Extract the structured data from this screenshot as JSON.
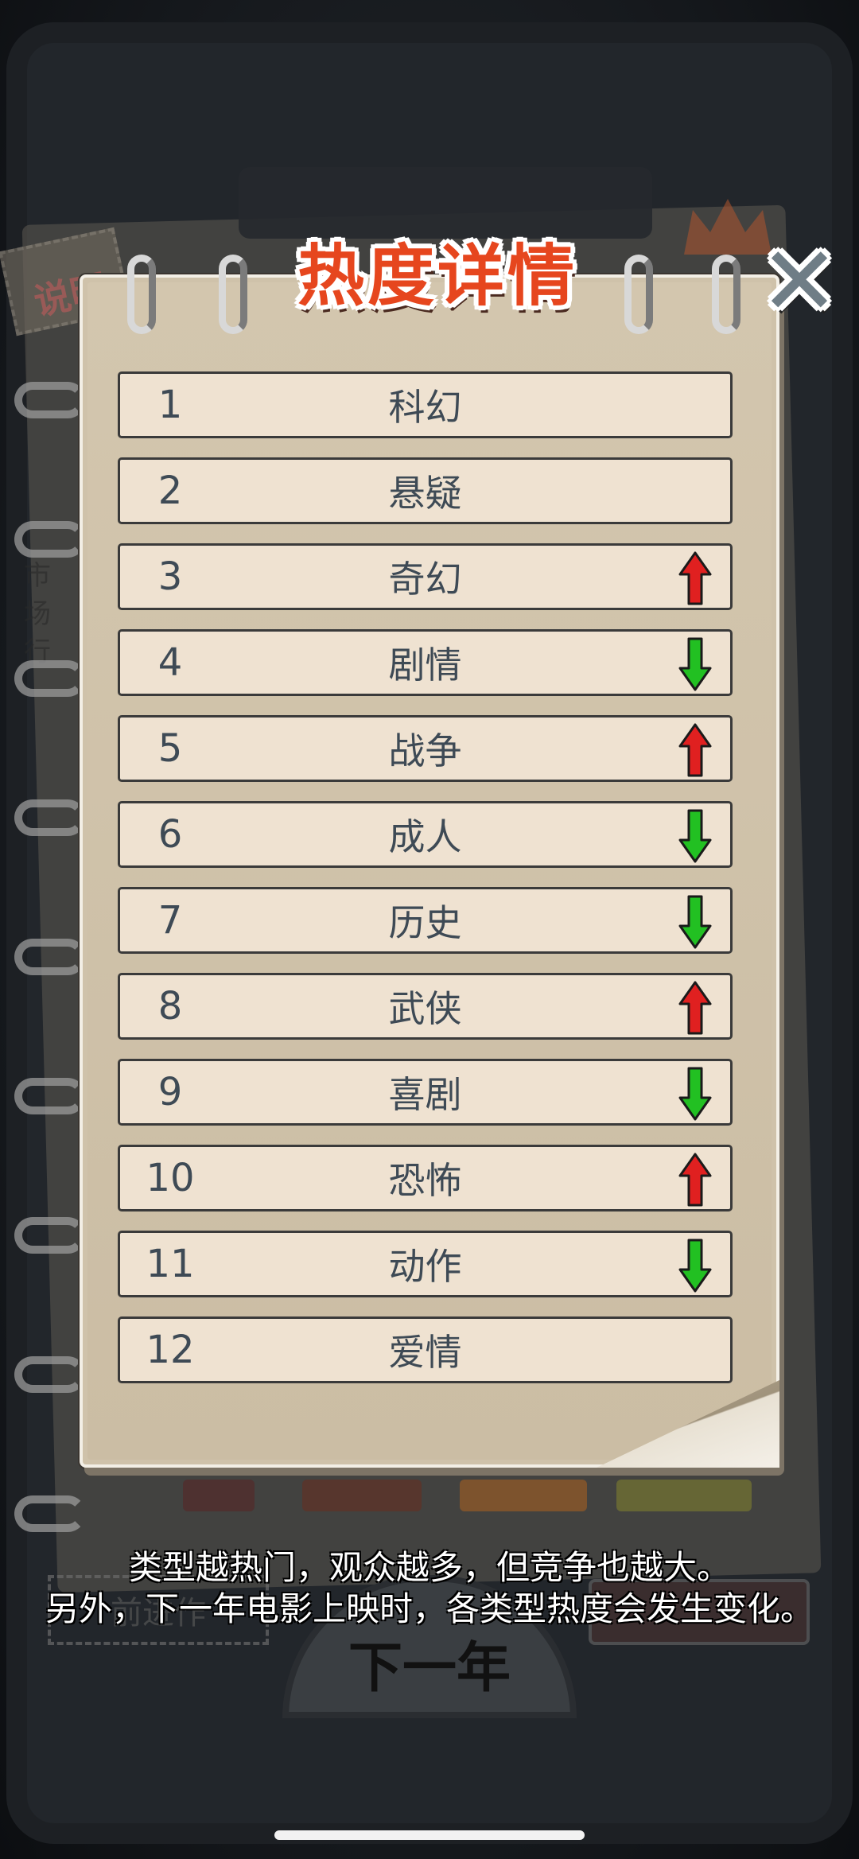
{
  "title": "热度详情",
  "close_symbol": "✕",
  "background": {
    "tag_label": "说明",
    "left_text": "市场行",
    "next_year_label": "下一年",
    "prev_label": "前进作"
  },
  "genres": [
    {
      "rank": "1",
      "name": "科幻",
      "trend": "none"
    },
    {
      "rank": "2",
      "name": "悬疑",
      "trend": "none"
    },
    {
      "rank": "3",
      "name": "奇幻",
      "trend": "up"
    },
    {
      "rank": "4",
      "name": "剧情",
      "trend": "down"
    },
    {
      "rank": "5",
      "name": "战争",
      "trend": "up"
    },
    {
      "rank": "6",
      "name": "成人",
      "trend": "down"
    },
    {
      "rank": "7",
      "name": "历史",
      "trend": "down"
    },
    {
      "rank": "8",
      "name": "武侠",
      "trend": "up"
    },
    {
      "rank": "9",
      "name": "喜剧",
      "trend": "down"
    },
    {
      "rank": "10",
      "name": "恐怖",
      "trend": "up"
    },
    {
      "rank": "11",
      "name": "动作",
      "trend": "down"
    },
    {
      "rank": "12",
      "name": "爱情",
      "trend": "none"
    }
  ],
  "caption": {
    "line1": "类型越热门，观众越多，但竞争也越大。",
    "line2": "另外，下一年电影上映时，各类型热度会发生变化。"
  },
  "colors": {
    "title": "#e6461e",
    "up_arrow": "#e02020",
    "down_arrow": "#22c022",
    "row_bg": "#efe2d1",
    "panel_bg": "#cfc2aa"
  }
}
